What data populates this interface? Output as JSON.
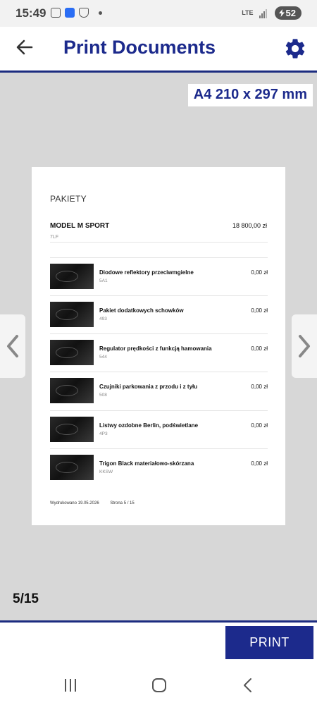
{
  "status_bar": {
    "time": "15:49",
    "network": "LTE",
    "battery": "52"
  },
  "app_bar": {
    "title": "Print Documents",
    "back_icon": "arrow-left-icon",
    "settings_icon": "gear-icon"
  },
  "preview": {
    "paper_size": "A4 210 x 297 mm",
    "page": {
      "section_title": "PAKIETY",
      "model": {
        "name": "MODEL M SPORT",
        "price": "18 800,00 zł",
        "code": "7LF"
      },
      "items": [
        {
          "name": "Diodowe reflektory przeciwmgielne",
          "code": "5A1",
          "price": "0,00 zł"
        },
        {
          "name": "Pakiet dodatkowych schowków",
          "code": "493",
          "price": "0,00 zł"
        },
        {
          "name": "Regulator prędkości z funkcją hamowania",
          "code": "544",
          "price": "0,00 zł"
        },
        {
          "name": "Czujniki parkowania z przodu i z tyłu",
          "code": "508",
          "price": "0,00 zł"
        },
        {
          "name": "Listwy ozdobne Berlin, podświetlane",
          "code": "4P3",
          "price": "0,00 zł"
        },
        {
          "name": "Trigon Black materiałowo-skórzana",
          "code": "KKSW",
          "price": "0,00 zł"
        }
      ],
      "footer_printed": "Wydrukowano 19.05.2026",
      "footer_page": "Strona 5 / 15"
    }
  },
  "page_counter": "5/15",
  "actions": {
    "print_label": "PRINT"
  },
  "colors": {
    "accent": "#1c2a8c",
    "preview_background": "#d7d7d7"
  }
}
